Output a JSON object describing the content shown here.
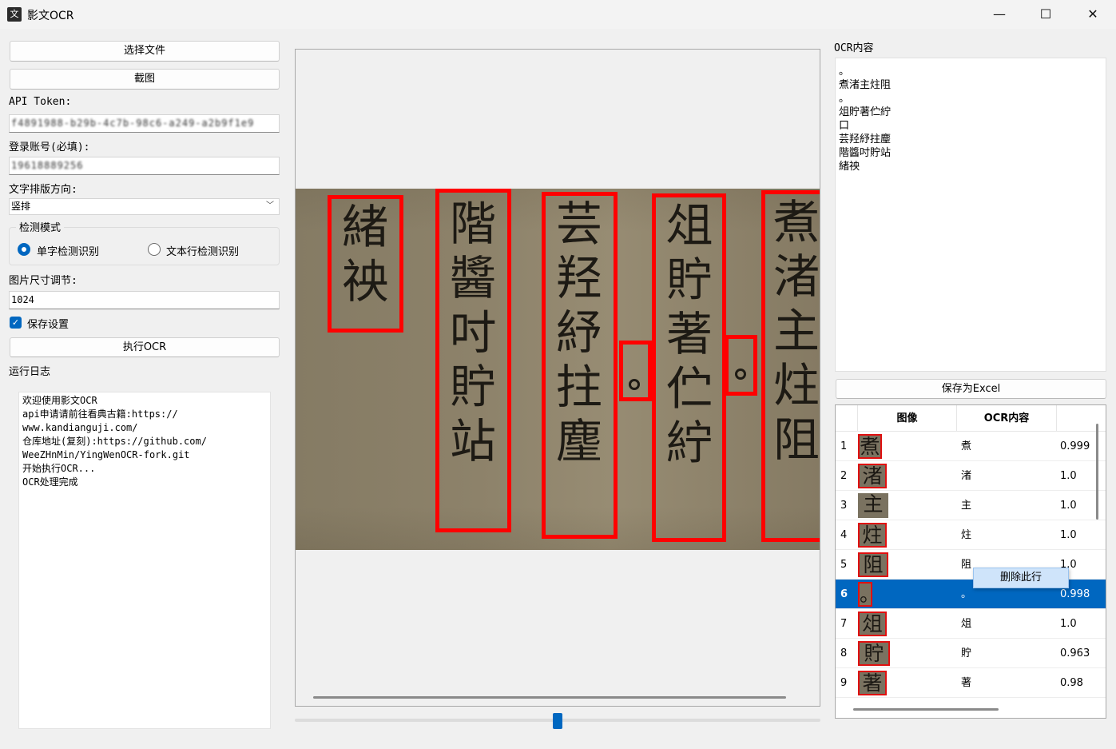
{
  "window": {
    "title": "影文OCR",
    "icon_text": "文",
    "controls": {
      "minimize": "—",
      "maximize": "☐",
      "close": "✕"
    }
  },
  "left": {
    "select_file_label": "选择文件",
    "screenshot_label": "截图",
    "api_token_label": "API Token:",
    "api_token_value": "f4891988-b29b-4c7b-98c6-a249-a2b9f1e9",
    "account_label": "登录账号(必填):",
    "account_value": "19618889256",
    "direction_label": "文字排版方向:",
    "direction_value": "竖排",
    "detect_mode_title": "检测模式",
    "radio_single": "单字检测识别",
    "radio_line": "文本行检测识别",
    "single_selected": true,
    "image_size_label": "图片尺寸调节:",
    "image_size_value": "1024",
    "save_settings_label": "保存设置",
    "save_settings_checked": true,
    "run_ocr_label": "执行OCR",
    "log_label": "运行日志",
    "log_lines": [
      "欢迎使用影文OCR",
      "api申请请前往看典古籍:https://",
      "www.kandianguji.com/",
      "仓库地址(复刻):https://github.com/",
      "WeeZHnMin/YingWenOCR-fork.git",
      "开始执行OCR...",
      "OCR处理完成"
    ]
  },
  "viewer": {
    "columns": [
      "緒䄃",
      "階醬吋貯站",
      "芸羟紓拄麈",
      "俎貯著伫紵",
      "煮渚主炷阻"
    ],
    "zoom_fraction": 0.5
  },
  "right": {
    "ocr_title": "OCR内容",
    "ocr_lines": [
      "。",
      "煮渚主炷阻",
      "。",
      "俎貯著伫紵",
      "口",
      "芸羟紓拄麈",
      "階醬吋貯站",
      "緒䄃"
    ],
    "save_excel_label": "保存为Excel",
    "table": {
      "headers": [
        "图像",
        "OCR内容"
      ],
      "rows": [
        {
          "index": "1",
          "glyph": "煮",
          "text": "煮",
          "score": "0.999"
        },
        {
          "index": "2",
          "glyph": "渚",
          "text": "渚",
          "score": "1.0"
        },
        {
          "index": "3",
          "glyph": "主",
          "text": "主",
          "score": "1.0"
        },
        {
          "index": "4",
          "glyph": "炷",
          "text": "炷",
          "score": "1.0"
        },
        {
          "index": "5",
          "glyph": "阻",
          "text": "阻",
          "score": "1.0"
        },
        {
          "index": "6",
          "glyph": "。",
          "text": "。",
          "score": "0.998"
        },
        {
          "index": "7",
          "glyph": "俎",
          "text": "俎",
          "score": "1.0"
        },
        {
          "index": "8",
          "glyph": "貯",
          "text": "貯",
          "score": "0.963"
        },
        {
          "index": "9",
          "glyph": "著",
          "text": "著",
          "score": "0.98"
        }
      ],
      "selected_index": "6"
    },
    "context_menu_item": "删除此行"
  }
}
